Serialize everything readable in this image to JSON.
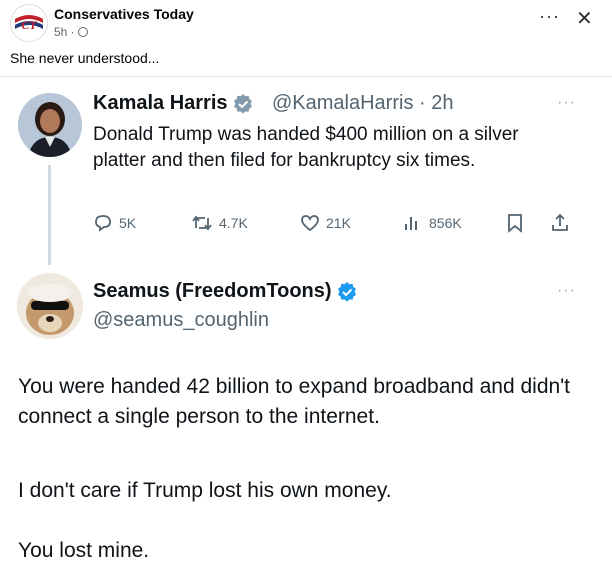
{
  "post": {
    "page_name": "Conservatives Today",
    "time": "5h ·",
    "caption": "She never understood...",
    "more_label": "···",
    "close_label": "✕"
  },
  "tweet1": {
    "name": "Kamala Harris",
    "handle": "@KamalaHarris · 2h",
    "text": "Donald Trump was handed $400 million on a silver platter and then filed for bankruptcy six times.",
    "replies": "5K",
    "retweets": "4.7K",
    "likes": "21K",
    "views": "856K",
    "more_label": "···"
  },
  "tweet2": {
    "name": "Seamus (FreedomToons)",
    "handle": "@seamus_coughlin",
    "para1": "You were handed 42 billion to expand broadband and didn't connect a single person to the internet.",
    "para2": "I don't care if Trump lost his own money.",
    "para3": "You lost mine.",
    "more_label": "···"
  },
  "colors": {
    "verified_gray": "#829aab",
    "verified_blue": "#1d9bf0",
    "muted": "#536471"
  },
  "icons": [
    "globe-icon",
    "more-icon",
    "close-icon",
    "verified-icon",
    "reply-icon",
    "retweet-icon",
    "like-icon",
    "views-icon",
    "bookmark-icon",
    "share-icon"
  ]
}
